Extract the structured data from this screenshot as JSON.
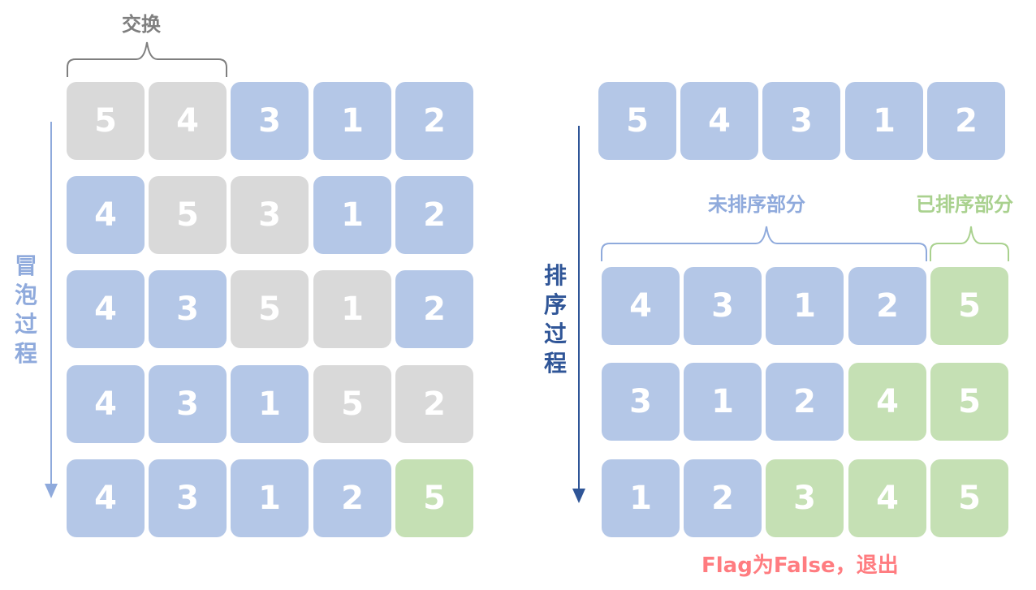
{
  "colors": {
    "unsorted": "#b4c7e7",
    "swapping": "#d9d9d9",
    "sorted": "#c5e0b4",
    "gray_text": "#7f7f7f",
    "light_blue_text": "#8faadc",
    "dark_blue_text": "#2f5597",
    "green_text": "#a9d18e",
    "red_text": "#ff7c80"
  },
  "left": {
    "swap_label": "交换",
    "vertical_label": "冒泡过程",
    "rows": [
      [
        {
          "v": "5",
          "s": "swapping"
        },
        {
          "v": "4",
          "s": "swapping"
        },
        {
          "v": "3",
          "s": "unsorted"
        },
        {
          "v": "1",
          "s": "unsorted"
        },
        {
          "v": "2",
          "s": "unsorted"
        }
      ],
      [
        {
          "v": "4",
          "s": "unsorted"
        },
        {
          "v": "5",
          "s": "swapping"
        },
        {
          "v": "3",
          "s": "swapping"
        },
        {
          "v": "1",
          "s": "unsorted"
        },
        {
          "v": "2",
          "s": "unsorted"
        }
      ],
      [
        {
          "v": "4",
          "s": "unsorted"
        },
        {
          "v": "3",
          "s": "unsorted"
        },
        {
          "v": "5",
          "s": "swapping"
        },
        {
          "v": "1",
          "s": "swapping"
        },
        {
          "v": "2",
          "s": "unsorted"
        }
      ],
      [
        {
          "v": "4",
          "s": "unsorted"
        },
        {
          "v": "3",
          "s": "unsorted"
        },
        {
          "v": "1",
          "s": "unsorted"
        },
        {
          "v": "5",
          "s": "swapping"
        },
        {
          "v": "2",
          "s": "swapping"
        }
      ],
      [
        {
          "v": "4",
          "s": "unsorted"
        },
        {
          "v": "3",
          "s": "unsorted"
        },
        {
          "v": "1",
          "s": "unsorted"
        },
        {
          "v": "2",
          "s": "unsorted"
        },
        {
          "v": "5",
          "s": "sorted"
        }
      ]
    ]
  },
  "right": {
    "vertical_label": "排序过程",
    "unsorted_label": "未排序部分",
    "sorted_label": "已排序部分",
    "exit_label": "Flag为False，退出",
    "rows": [
      [
        {
          "v": "5",
          "s": "unsorted"
        },
        {
          "v": "4",
          "s": "unsorted"
        },
        {
          "v": "3",
          "s": "unsorted"
        },
        {
          "v": "1",
          "s": "unsorted"
        },
        {
          "v": "2",
          "s": "unsorted"
        }
      ],
      [
        {
          "v": "4",
          "s": "unsorted"
        },
        {
          "v": "3",
          "s": "unsorted"
        },
        {
          "v": "1",
          "s": "unsorted"
        },
        {
          "v": "2",
          "s": "unsorted"
        },
        {
          "v": "5",
          "s": "sorted"
        }
      ],
      [
        {
          "v": "3",
          "s": "unsorted"
        },
        {
          "v": "1",
          "s": "unsorted"
        },
        {
          "v": "2",
          "s": "unsorted"
        },
        {
          "v": "4",
          "s": "sorted"
        },
        {
          "v": "5",
          "s": "sorted"
        }
      ],
      [
        {
          "v": "1",
          "s": "unsorted"
        },
        {
          "v": "2",
          "s": "unsorted"
        },
        {
          "v": "3",
          "s": "sorted"
        },
        {
          "v": "4",
          "s": "sorted"
        },
        {
          "v": "5",
          "s": "sorted"
        }
      ]
    ]
  }
}
